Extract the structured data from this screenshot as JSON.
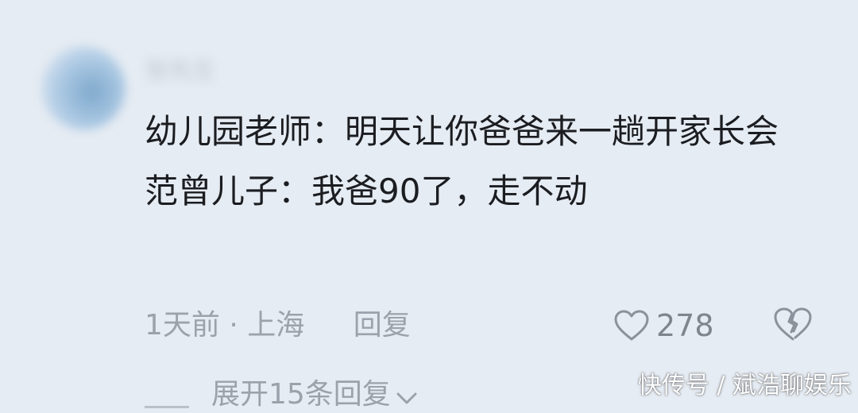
{
  "comment": {
    "username": "张先生",
    "content_line1": "幼儿园老师：明天让你爸爸来一趟开家长会",
    "content_line2": "范曾儿子：我爸90了，走不动",
    "time": "1天前",
    "separator": "·",
    "location": "上海",
    "reply_label": "回复",
    "likes": "278",
    "expand_label": "展开15条回复"
  },
  "watermark": "快传号 / 斌浩聊娱乐",
  "icons": {
    "avatar": "avatar",
    "like": "heart-icon",
    "dislike": "broken-heart-icon",
    "expand": "chevron-down-icon"
  }
}
